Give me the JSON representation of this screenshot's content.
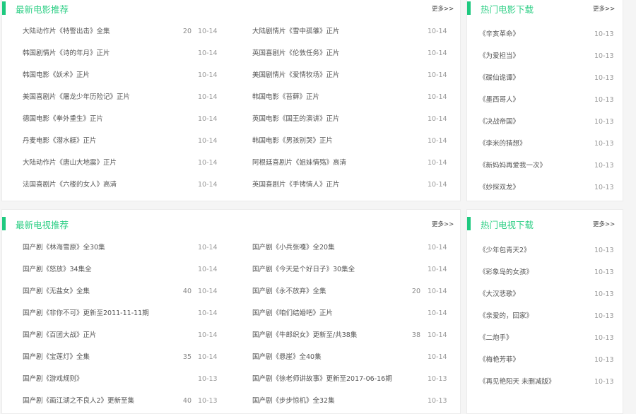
{
  "movies": {
    "title": "最新电影推荐",
    "more": "更多>>",
    "left": [
      {
        "name": "大陆动作片《特警出击》全集",
        "count": "20",
        "date": "10-14"
      },
      {
        "name": "韩国剧情片《诗的年月》正片",
        "count": "",
        "date": "10-14"
      },
      {
        "name": "韩国电影《妖术》正片",
        "count": "",
        "date": "10-14"
      },
      {
        "name": "美国喜剧片《屠龙少年历险记》正片",
        "count": "",
        "date": "10-14"
      },
      {
        "name": "德国电影《拳外重生》正片",
        "count": "",
        "date": "10-14"
      },
      {
        "name": "丹麦电影《潜水艇》正片",
        "count": "",
        "date": "10-14"
      },
      {
        "name": "大陆动作片《唐山大地震》正片",
        "count": "",
        "date": "10-14"
      },
      {
        "name": "法国喜剧片《六楼的女人》高清",
        "count": "",
        "date": "10-14"
      }
    ],
    "right": [
      {
        "name": "大陆剧情片《雪中孤雏》正片",
        "count": "",
        "date": "10-14"
      },
      {
        "name": "英国喜剧片《伦敦任务》正片",
        "count": "",
        "date": "10-14"
      },
      {
        "name": "美国剧情片《爱情牧场》正片",
        "count": "",
        "date": "10-14"
      },
      {
        "name": "韩国电影《苔藓》正片",
        "count": "",
        "date": "10-14"
      },
      {
        "name": "英国电影《国王的演讲》正片",
        "count": "",
        "date": "10-14"
      },
      {
        "name": "韩国电影《男孩别哭》正片",
        "count": "",
        "date": "10-14"
      },
      {
        "name": "阿根廷喜剧片《姐妹情殇》高清",
        "count": "",
        "date": "10-14"
      },
      {
        "name": "英国喜剧片《手铐情人》正片",
        "count": "",
        "date": "10-14"
      }
    ]
  },
  "hot_movies": {
    "title": "热门电影下载",
    "more": "更多>>",
    "items": [
      {
        "name": "《辛亥革命》",
        "date": "10-13"
      },
      {
        "name": "《为爱担当》",
        "date": "10-13"
      },
      {
        "name": "《碟仙诡谭》",
        "date": "10-13"
      },
      {
        "name": "《墨西哥人》",
        "date": "10-13"
      },
      {
        "name": "《决战帝国》",
        "date": "10-13"
      },
      {
        "name": "《李米的猜想》",
        "date": "10-13"
      },
      {
        "name": "《新妈妈再爱我一次》",
        "date": "10-13"
      },
      {
        "name": "《妙探双龙》",
        "date": "10-13"
      }
    ]
  },
  "tv": {
    "title": "最新电视推荐",
    "more": "更多>>",
    "left": [
      {
        "name": "国产剧《林海雪原》全30集",
        "count": "",
        "date": "10-14"
      },
      {
        "name": "国产剧《怒放》34集全",
        "count": "",
        "date": "10-14"
      },
      {
        "name": "国产剧《无盐女》全集",
        "count": "40",
        "date": "10-14"
      },
      {
        "name": "国产剧《非你不可》更新至2011-11-11期",
        "count": "",
        "date": "10-14"
      },
      {
        "name": "国产剧《百团大战》正片",
        "count": "",
        "date": "10-14"
      },
      {
        "name": "国产剧《宝莲灯》全集",
        "count": "35",
        "date": "10-14"
      },
      {
        "name": "国产剧《游戏规则》",
        "count": "",
        "date": "10-13"
      },
      {
        "name": "国产剧《画江湖之不良人2》更新至集",
        "count": "40",
        "date": "10-13"
      }
    ],
    "right": [
      {
        "name": "国产剧《小兵张嘎》全20集",
        "count": "",
        "date": "10-14"
      },
      {
        "name": "国产剧《今天是个好日子》30集全",
        "count": "",
        "date": "10-14"
      },
      {
        "name": "国产剧《永不放弃》全集",
        "count": "20",
        "date": "10-14"
      },
      {
        "name": "国产剧《咱们结婚吧》正片",
        "count": "",
        "date": "10-14"
      },
      {
        "name": "国产剧《牛郎织女》更新至/共38集",
        "count": "38",
        "date": "10-14"
      },
      {
        "name": "国产剧《悬崖》全40集",
        "count": "",
        "date": "10-14"
      },
      {
        "name": "国产剧《徐老师讲故事》更新至2017-06-16期",
        "count": "",
        "date": "10-13"
      },
      {
        "name": "国产剧《步步惊机》全32集",
        "count": "",
        "date": "10-13"
      }
    ]
  },
  "hot_tv": {
    "title": "热门电视下载",
    "more": "更多>>",
    "items": [
      {
        "name": "《少年包青天2》",
        "date": "10-13"
      },
      {
        "name": "《彩象岛的女孩》",
        "date": "10-13"
      },
      {
        "name": "《大汉悲歌》",
        "date": "10-13"
      },
      {
        "name": "《亲爱的，回家》",
        "date": "10-13"
      },
      {
        "name": "《二炮手》",
        "date": "10-13"
      },
      {
        "name": "《梅艳芳菲》",
        "date": "10-13"
      },
      {
        "name": "《再见艳阳天 未删减版》",
        "date": "10-13"
      }
    ]
  }
}
